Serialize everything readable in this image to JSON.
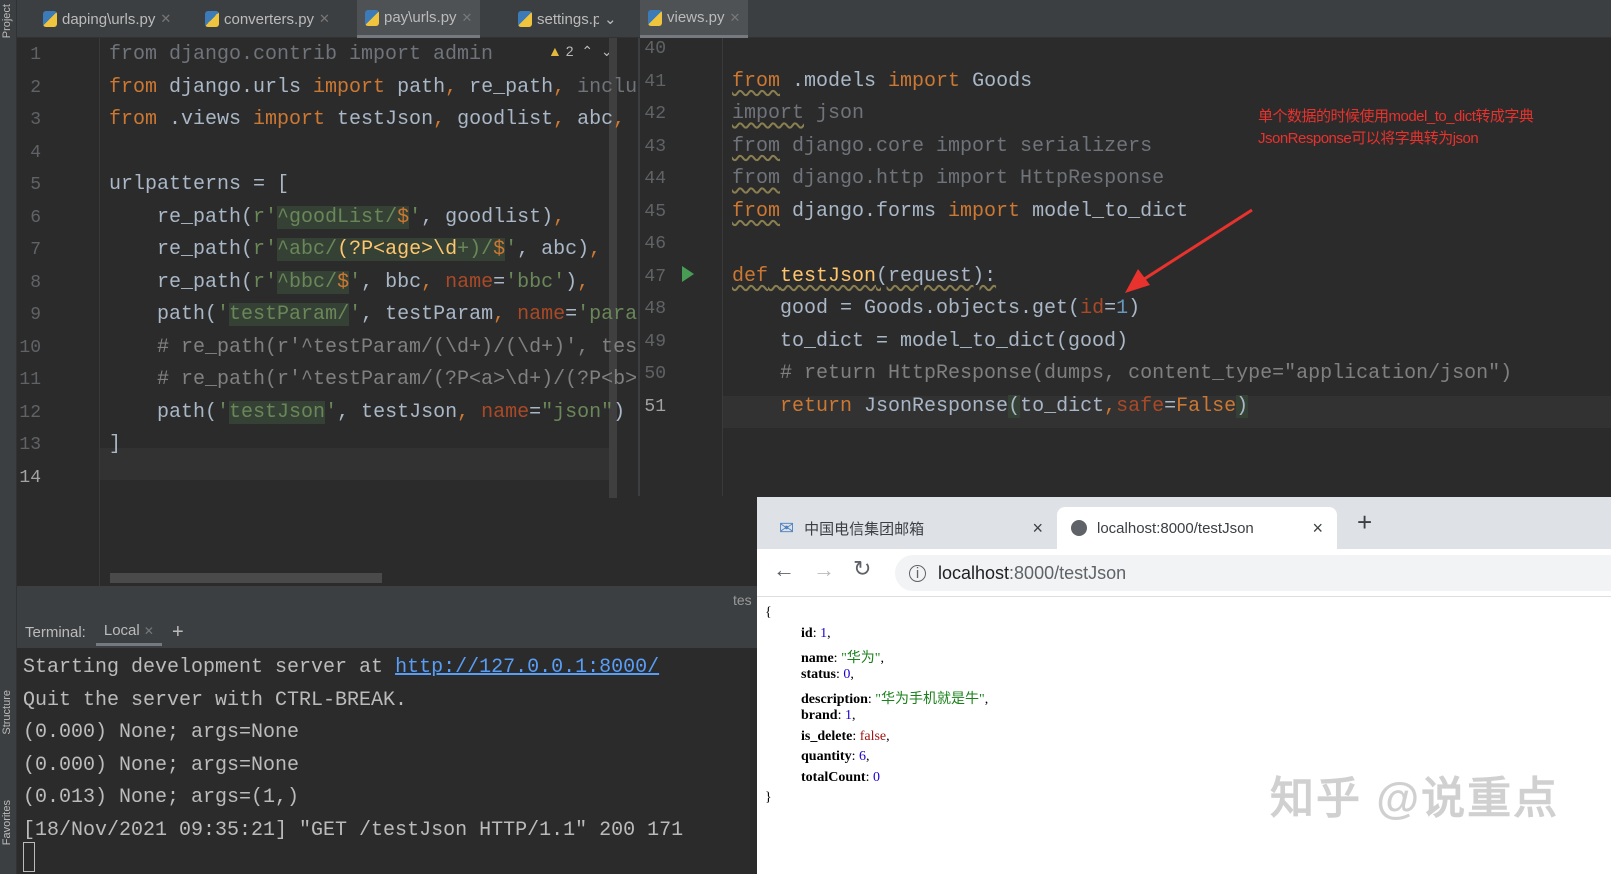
{
  "sidebar": {
    "project": "Project",
    "structure": "Structure",
    "favorites": "Favorites"
  },
  "tabs": [
    {
      "label": "daping\\urls.py"
    },
    {
      "label": "converters.py"
    },
    {
      "label": "pay\\urls.py"
    },
    {
      "label": "settings.py"
    },
    {
      "label": "views.py"
    }
  ],
  "left_editor": {
    "warning_count": "2",
    "lines": [
      {
        "n": "1",
        "t": [
          [
            "from django.contrib import admin",
            "dim"
          ]
        ]
      },
      {
        "n": "2",
        "t": [
          [
            "from",
            "kw"
          ],
          [
            " django.urls ",
            ""
          ],
          [
            "import",
            "kw"
          ],
          [
            " path",
            ""
          ],
          [
            ",",
            "kw"
          ],
          [
            " re_path",
            ""
          ],
          [
            ",",
            "kw"
          ],
          [
            " inclu",
            "dim"
          ]
        ]
      },
      {
        "n": "3",
        "t": [
          [
            "from",
            "kw"
          ],
          [
            " .views ",
            ""
          ],
          [
            "import",
            "kw"
          ],
          [
            " testJson",
            ""
          ],
          [
            ",",
            "kw"
          ],
          [
            " goodlist",
            ""
          ],
          [
            ",",
            "kw"
          ],
          [
            " abc",
            ""
          ],
          [
            ",",
            "kw"
          ]
        ]
      },
      {
        "n": "4",
        "t": []
      },
      {
        "n": "5",
        "t": [
          [
            "urlpatterns = [",
            ""
          ]
        ]
      },
      {
        "n": "6",
        "t": [
          [
            "    re_path(",
            ""
          ],
          [
            "r'",
            "str"
          ],
          [
            "^goodList/",
            "re"
          ],
          [
            "$",
            "reb"
          ],
          [
            "'",
            "str"
          ],
          [
            ", goodlist)",
            ""
          ],
          [
            ",",
            "kw"
          ]
        ]
      },
      {
        "n": "7",
        "t": [
          [
            "    re_path(",
            ""
          ],
          [
            "r'",
            "str"
          ],
          [
            "^abc/",
            "re"
          ],
          [
            "(?P<age>",
            "rey"
          ],
          [
            "\\d",
            "rey"
          ],
          [
            "+)/",
            "re"
          ],
          [
            "$",
            "reb"
          ],
          [
            "'",
            "str"
          ],
          [
            ", abc)",
            ""
          ],
          [
            ",",
            "kw"
          ]
        ]
      },
      {
        "n": "8",
        "t": [
          [
            "    re_path(",
            ""
          ],
          [
            "r'",
            "str"
          ],
          [
            "^bbc/",
            "re"
          ],
          [
            "$",
            "reb"
          ],
          [
            "'",
            "str"
          ],
          [
            ", bbc",
            ""
          ],
          [
            ", ",
            "kw"
          ],
          [
            "name",
            "prm"
          ],
          [
            "=",
            ""
          ],
          [
            "'bbc'",
            "str"
          ],
          [
            ")",
            ""
          ],
          [
            ",",
            "kw"
          ]
        ]
      },
      {
        "n": "9",
        "t": [
          [
            "    path(",
            ""
          ],
          [
            "'",
            "str"
          ],
          [
            "testParam/",
            "re"
          ],
          [
            "'",
            "str"
          ],
          [
            ", testParam",
            ""
          ],
          [
            ", ",
            "kw"
          ],
          [
            "name",
            "prm"
          ],
          [
            "=",
            ""
          ],
          [
            "'para",
            "str"
          ]
        ]
      },
      {
        "n": "10",
        "t": [
          [
            "    # re_path(r'^testParam/(\\d+)/(\\d+)', tes",
            "cmt"
          ]
        ]
      },
      {
        "n": "11",
        "t": [
          [
            "    # re_path(r'^testParam/(?P<a>\\d+)/(?P<b>",
            "cmt"
          ]
        ]
      },
      {
        "n": "12",
        "t": [
          [
            "    path(",
            ""
          ],
          [
            "'",
            "str"
          ],
          [
            "testJson",
            "re"
          ],
          [
            "'",
            "str"
          ],
          [
            ", testJson",
            ""
          ],
          [
            ", ",
            "kw"
          ],
          [
            "name",
            "prm"
          ],
          [
            "=",
            ""
          ],
          [
            "\"json\"",
            "str"
          ],
          [
            ")",
            ""
          ]
        ]
      },
      {
        "n": "13",
        "t": [
          [
            "]",
            ""
          ]
        ]
      },
      {
        "n": "14",
        "t": []
      }
    ]
  },
  "right_editor": {
    "lines": [
      {
        "n": "40",
        "t": []
      },
      {
        "n": "41",
        "t": [
          [
            "from",
            "kw u"
          ],
          [
            " .models ",
            ""
          ],
          [
            "import",
            "kw"
          ],
          [
            " Goods",
            ""
          ]
        ]
      },
      {
        "n": "42",
        "t": [
          [
            "import",
            "dim u"
          ],
          [
            " json",
            "dim"
          ]
        ]
      },
      {
        "n": "43",
        "t": [
          [
            "from",
            "dim u"
          ],
          [
            " django.core import serializers",
            "dim"
          ]
        ]
      },
      {
        "n": "44",
        "t": [
          [
            "from",
            "dim u"
          ],
          [
            " django.http import HttpResponse",
            "dim"
          ]
        ]
      },
      {
        "n": "45",
        "t": [
          [
            "from",
            "kw u"
          ],
          [
            " django.forms ",
            ""
          ],
          [
            "import",
            "kw"
          ],
          [
            " model_to_dict",
            ""
          ]
        ]
      },
      {
        "n": "46",
        "t": []
      },
      {
        "n": "47",
        "t": [
          [
            "def",
            "kw u"
          ],
          [
            " ",
            "u"
          ],
          [
            "testJson",
            "fn u"
          ],
          [
            "(request):",
            "u"
          ]
        ]
      },
      {
        "n": "48",
        "t": [
          [
            "    good = Goods.objects.get(",
            ""
          ],
          [
            "id",
            "prm"
          ],
          [
            "=",
            ""
          ],
          [
            "1",
            "num"
          ],
          [
            ")",
            ""
          ]
        ]
      },
      {
        "n": "49",
        "t": [
          [
            "    to_dict = model_to_dict(good)",
            ""
          ]
        ]
      },
      {
        "n": "50",
        "t": [
          [
            "    # return HttpResponse(dumps, content_type=\"application/json\")",
            "cmt"
          ]
        ]
      },
      {
        "n": "51",
        "t": [
          [
            "    ",
            ""
          ],
          [
            "return",
            "kw"
          ],
          [
            " JsonResponse",
            ""
          ],
          [
            "(",
            "hl"
          ],
          [
            "to_dict",
            ""
          ],
          [
            ",",
            "kw"
          ],
          [
            "safe",
            "prm"
          ],
          [
            "=",
            ""
          ],
          [
            "False",
            "kw"
          ],
          [
            ")",
            "hl"
          ]
        ]
      }
    ]
  },
  "annotation": {
    "line1": "单个数据的时候使用model_to_dict转成字典",
    "line2": "JsonResponse可以将字典转为json",
    "color": "#e8322d"
  },
  "terminal": {
    "label": "Terminal:",
    "tab": "Local",
    "add": "+",
    "partial_tab": "tes",
    "lines": [
      {
        "pre": "Starting development server at ",
        "link": "http://127.0.0.1:8000/"
      },
      {
        "pre": "Quit the server with CTRL-BREAK."
      },
      {
        "pre": "(0.000) None; args=None"
      },
      {
        "pre": "(0.000) None; args=None"
      },
      {
        "pre": "(0.013) None; args=(1,)"
      },
      {
        "pre": "[18/Nov/2021 09:35:21] \"GET /testJson HTTP/1.1\" 200 171"
      }
    ]
  },
  "browser": {
    "tab1": "中国电信集团邮箱",
    "tab2": "localhost:8000/testJson",
    "new_tab": "+",
    "close": "×",
    "url_host": "localhost",
    "url_rest": ":8000/testJson",
    "json": {
      "open": "{",
      "close": "}",
      "rows": [
        {
          "k": "id",
          "v": "1",
          "c": "jn"
        },
        {
          "k": "name",
          "v": "\"华为\"",
          "c": "js"
        },
        {
          "k": "status",
          "v": "0",
          "c": "jn"
        },
        {
          "k": "description",
          "v": "\"华为手机就是牛\"",
          "c": "js"
        },
        {
          "k": "brand",
          "v": "1",
          "c": "jn"
        },
        {
          "k": "is_delete",
          "v": "false",
          "c": "jb"
        },
        {
          "k": "quantity",
          "v": "6",
          "c": "jn"
        },
        {
          "k": "totalCount",
          "v": "0",
          "c": "jn",
          "last": true
        }
      ]
    }
  },
  "watermark": "知乎 @说重点"
}
